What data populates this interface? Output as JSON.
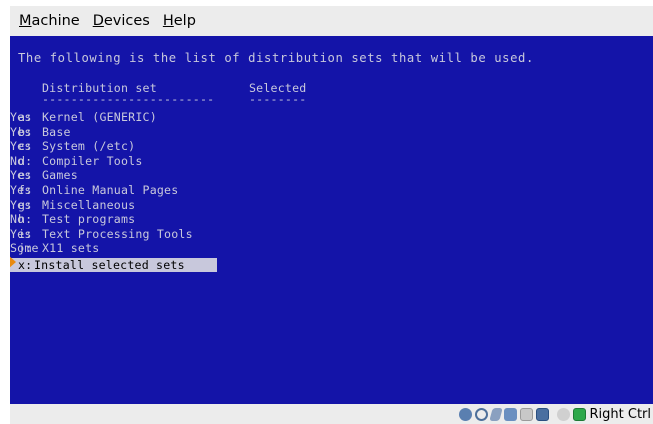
{
  "menu": {
    "items": [
      "Machine",
      "Devices",
      "Help"
    ]
  },
  "screen": {
    "intro": "The following is the list of distribution sets that will be used.",
    "headers": {
      "set": "Distribution set",
      "selected": "Selected"
    },
    "dividers": {
      "set": "------------------------",
      "selected": "--------"
    },
    "rows": [
      {
        "key": "a:",
        "name": "Kernel (GENERIC)",
        "value": "Yes"
      },
      {
        "key": "b:",
        "name": "Base",
        "value": "Yes"
      },
      {
        "key": "c:",
        "name": "System (/etc)",
        "value": "Yes"
      },
      {
        "key": "d:",
        "name": "Compiler Tools",
        "value": "No"
      },
      {
        "key": "e:",
        "name": "Games",
        "value": "Yes"
      },
      {
        "key": "f:",
        "name": "Online Manual Pages",
        "value": "Yes"
      },
      {
        "key": "g:",
        "name": "Miscellaneous",
        "value": "Yes"
      },
      {
        "key": "h:",
        "name": "Test programs",
        "value": "No"
      },
      {
        "key": "i:",
        "name": "Text Processing Tools",
        "value": "Yes"
      },
      {
        "key": "j:",
        "name": "X11 sets",
        "value": "Some"
      }
    ],
    "selected_row": {
      "key": "x:",
      "name": "Install selected sets"
    }
  },
  "statusbar": {
    "icons": [
      "hard-disk-icon",
      "optical-drive-icon",
      "usb-icon",
      "network-icon",
      "shared-folders-icon",
      "display-icon",
      "recording-icon",
      "mouse-integration-icon"
    ],
    "host_key": "Right Ctrl"
  },
  "colors": {
    "screen_bg": "#1414a8",
    "screen_text": "#c8c8dc",
    "highlight_bg": "#c8c8dc",
    "cursor": "#e88a10"
  }
}
